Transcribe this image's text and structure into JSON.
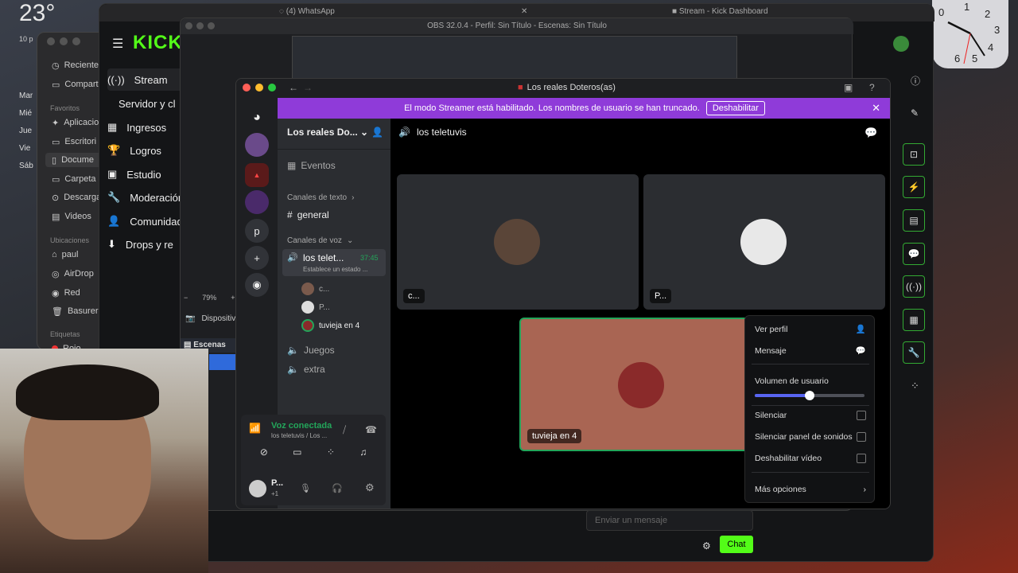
{
  "desktop": {
    "temperature": "23°",
    "finder_small_label": "10 p",
    "widget_days": [
      "Mar",
      "Mié",
      "Jue",
      "Vie",
      "Sáb"
    ],
    "clock_numbers": [
      "0",
      "1",
      "2",
      "3",
      "4",
      "5",
      "6"
    ]
  },
  "browser": {
    "tab_whatsapp": "(4) WhatsApp",
    "tab_kick": "Stream - Kick Dashboard"
  },
  "finder": {
    "items_top": [
      "Reciente",
      "Compart"
    ],
    "favorites_label": "Favoritos",
    "favorites": [
      "Aplicacio",
      "Escritori",
      "Docume",
      "Carpeta",
      "Descarga",
      "Videos"
    ],
    "locations_label": "Ubicaciones",
    "locations": [
      "paul",
      "AirDrop",
      "Red",
      "Basurero"
    ],
    "tags_label": "Etiquetas",
    "tags": [
      "Rojo"
    ]
  },
  "kick": {
    "logo": "KICK",
    "nav": [
      "Stream",
      "Servidor y cl",
      "Ingresos",
      "Logros",
      "Estudio",
      "Moderación",
      "Comunidad",
      "Drops y re"
    ],
    "chat_input_placeholder": "Enviar un mensaje",
    "chat_button": "Chat"
  },
  "obs": {
    "title": "OBS 32.0.4 - Perfil: Sin Título - Escenas: Sin Título",
    "zoom": "79%",
    "device_label": "Dispositiv",
    "scenes_label": "Escenas"
  },
  "discord": {
    "window_title": "Los reales Doteros(as)",
    "banner_text": "El modo Streamer está habilitado. Los nombres de usuario se han truncado.",
    "banner_button": "Deshabilitar",
    "server_name": "Los reales Do...",
    "server_letter": "p",
    "events": "Eventos",
    "text_channels_label": "Canales de texto",
    "text_channel": "general",
    "voice_channels_label": "Canales de voz",
    "voice_channel": "los telet...",
    "voice_timer": "37:45",
    "voice_status": "Establece un estado ...",
    "voice_users": [
      "c...",
      "P...",
      "tuvieja en 4"
    ],
    "other_voice_channels": [
      "Juegos",
      "extra"
    ],
    "voice_connected": "Voz conectada",
    "voice_connected_sub": "los teletuvis / Los ...",
    "user_name": "P...",
    "user_sub": "+1",
    "channel_header": "los teletuvis",
    "tiles": [
      {
        "name": "c..."
      },
      {
        "name": "P..."
      },
      {
        "name": "tuvieja en 4"
      }
    ],
    "context_menu": {
      "view_profile": "Ver perfil",
      "message": "Mensaje",
      "user_volume": "Volumen de usuario",
      "user_volume_value": 0.5,
      "mute": "Silenciar",
      "mute_soundboard": "Silenciar panel de sonidos",
      "disable_video": "Deshabilitar vídeo",
      "more_options": "Más opciones"
    },
    "accent_color": "#8f3bd9",
    "connected_color": "#23a55a",
    "hangup_color": "#da373c"
  }
}
